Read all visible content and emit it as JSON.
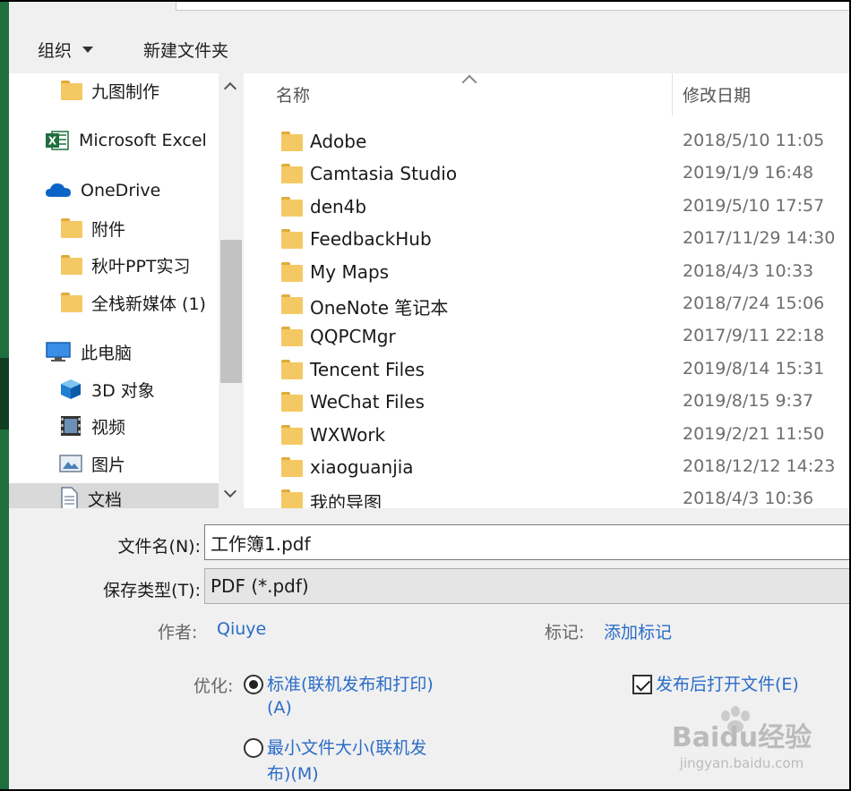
{
  "toolbar": {
    "organize_label": "组织",
    "new_folder_label": "新建文件夹"
  },
  "nav": {
    "items": [
      {
        "label": "九图制作",
        "icon": "folder-icon"
      },
      {
        "label": "Microsoft Excel",
        "icon": "excel-icon"
      },
      {
        "label": "OneDrive",
        "icon": "onedrive-cloud-icon"
      },
      {
        "label": "附件",
        "icon": "folder-icon"
      },
      {
        "label": "秋叶PPT实习",
        "icon": "folder-icon"
      },
      {
        "label": "全栈新媒体 (1)",
        "icon": "folder-icon"
      },
      {
        "label": "此电脑",
        "icon": "computer-icon"
      },
      {
        "label": "3D 对象",
        "icon": "3d-objects-icon"
      },
      {
        "label": "视频",
        "icon": "video-icon"
      },
      {
        "label": "图片",
        "icon": "pictures-icon"
      },
      {
        "label": "文档",
        "icon": "documents-icon"
      }
    ]
  },
  "list": {
    "col_name": "名称",
    "col_date": "修改日期",
    "rows": [
      {
        "name": "Adobe",
        "date": "2018/5/10 11:05"
      },
      {
        "name": "Camtasia Studio",
        "date": "2019/1/9 16:48"
      },
      {
        "name": "den4b",
        "date": "2019/5/10 17:57"
      },
      {
        "name": "FeedbackHub",
        "date": "2017/11/29 14:30"
      },
      {
        "name": "My Maps",
        "date": "2018/4/3 10:33"
      },
      {
        "name": "OneNote 笔记本",
        "date": "2018/7/24 15:06"
      },
      {
        "name": "QQPCMgr",
        "date": "2017/9/11 22:18"
      },
      {
        "name": "Tencent Files",
        "date": "2019/8/14 15:31"
      },
      {
        "name": "WeChat Files",
        "date": "2019/8/15 9:37"
      },
      {
        "name": "WXWork",
        "date": "2019/2/21 11:50"
      },
      {
        "name": "xiaoguanjia",
        "date": "2018/12/12 14:23"
      },
      {
        "name": "我的导图",
        "date": "2018/4/3 10:36"
      }
    ]
  },
  "save": {
    "filename_label": "文件名(N):",
    "filename_value": "工作簿1.pdf",
    "type_label": "保存类型(T):",
    "type_value": "PDF (*.pdf)",
    "author_label": "作者:",
    "author_value": "Qiuye",
    "tags_label": "标记:",
    "tags_value": "添加标记",
    "optimize_label": "优化:",
    "opt_standard_line1": "标准(联机发布和打印)",
    "opt_standard_line2": "(A)",
    "opt_min_line1": "最小文件大小(联机发",
    "opt_min_line2": "布)(M)",
    "open_after_label": "发布后打开文件(E)"
  },
  "watermark": {
    "brand": "Baidu经验",
    "url": "jingyan.baidu.com"
  },
  "colors": {
    "link": "#2a6cc8",
    "folder": "#f4c964",
    "excel_green": "#1e6e3e",
    "onedrive_blue": "#0a64c8"
  }
}
